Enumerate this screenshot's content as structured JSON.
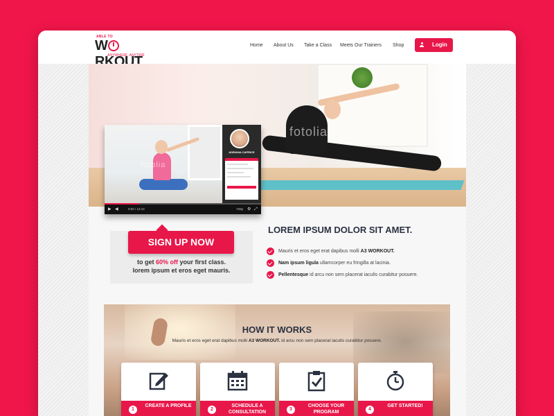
{
  "brand": {
    "pre": "ABLE TO",
    "name_start": "W",
    "name_end": "RKOUT",
    "tagline": "ANYWHERE, ANYTIME"
  },
  "nav": {
    "items": [
      "Home",
      "About Us",
      "Take a Class",
      "Meets Our Trainers",
      "Shop"
    ],
    "login_label": "Login"
  },
  "hero": {
    "watermark_main": "fotolia",
    "watermark_video": "fotolia"
  },
  "video": {
    "instructor_name": "ADRIANA CAPRICE",
    "time": "0:02 / 12:14",
    "quality": "720p",
    "progress": 0.22
  },
  "signup": {
    "button_label": "SIGN UP NOW",
    "line1_pre": "to get ",
    "line1_highlight": "60% off",
    "line1_post": " your first class.",
    "line2": "lorem ipsum et eros eget mauris."
  },
  "features": {
    "title": "LOREM IPSUM DOLOR SIT AMET.",
    "items": [
      {
        "pre": "Mauris et eros eget erat dapibus molli ",
        "bold": "A3 WORKOUT.",
        "post": ""
      },
      {
        "pre": "",
        "bold": "Nam ipsum ligula",
        "post": " ullamcorper eu fringilla at lacinia."
      },
      {
        "pre": "",
        "bold": "Pellentesque",
        "post": " id arcu non sem placerat iaculis curabitur posuere."
      }
    ]
  },
  "how_it_works": {
    "title": "HOW IT WORKS",
    "subtitle_pre": "Mauris et eros eget erat dapibus molli ",
    "subtitle_bold": "A3 WORKOUT.",
    "subtitle_post": " id arcu non sem placerat iaculis curabitur posuere.",
    "steps": [
      {
        "number": "1",
        "label": "CREATE A PROFILE",
        "icon": "edit-icon"
      },
      {
        "number": "2",
        "label": "SCHEDULE A CONSULTATION",
        "icon": "calendar-icon"
      },
      {
        "number": "3",
        "label": "CHOOSE YOUR PROGRAM",
        "icon": "clipboard-icon"
      },
      {
        "number": "4",
        "label": "GET STARTED!",
        "icon": "stopwatch-icon"
      }
    ]
  },
  "colors": {
    "accent": "#e8174a",
    "background": "#f0164a",
    "heading": "#2a3140"
  }
}
